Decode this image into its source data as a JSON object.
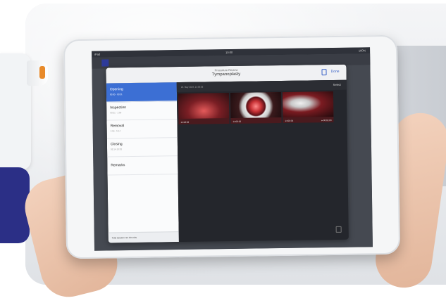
{
  "status_bar": {
    "left": "iPad",
    "time": "10:00",
    "right": "100%"
  },
  "modal": {
    "subtitle": "Procedure Review",
    "title": "Tympanoplasty",
    "done_label": "Done",
    "date": "23. May 2019, 14:03:26",
    "select_label": "Select",
    "total_duration": "Total duration: 0h 10m 03s"
  },
  "steps": [
    {
      "name": "Opening",
      "sub": "00:00 - 00:31"
    },
    {
      "name": "Inspection",
      "sub": "00:31 - 1:56"
    },
    {
      "name": "Removal",
      "sub": "1:56 - 5:14"
    },
    {
      "name": "Closing",
      "sub": "05:14-10:03"
    },
    {
      "name": "Remarks",
      "sub": ""
    }
  ],
  "thumbnails": [
    {
      "time": "14:03:33",
      "extra": ""
    },
    {
      "time": "14:03:32",
      "extra": ""
    },
    {
      "time": "14:03:34",
      "extra": "▸ 00:01:03"
    }
  ],
  "colors": {
    "accent": "#3c6fd4",
    "brand_blue": "#2b2f86"
  }
}
